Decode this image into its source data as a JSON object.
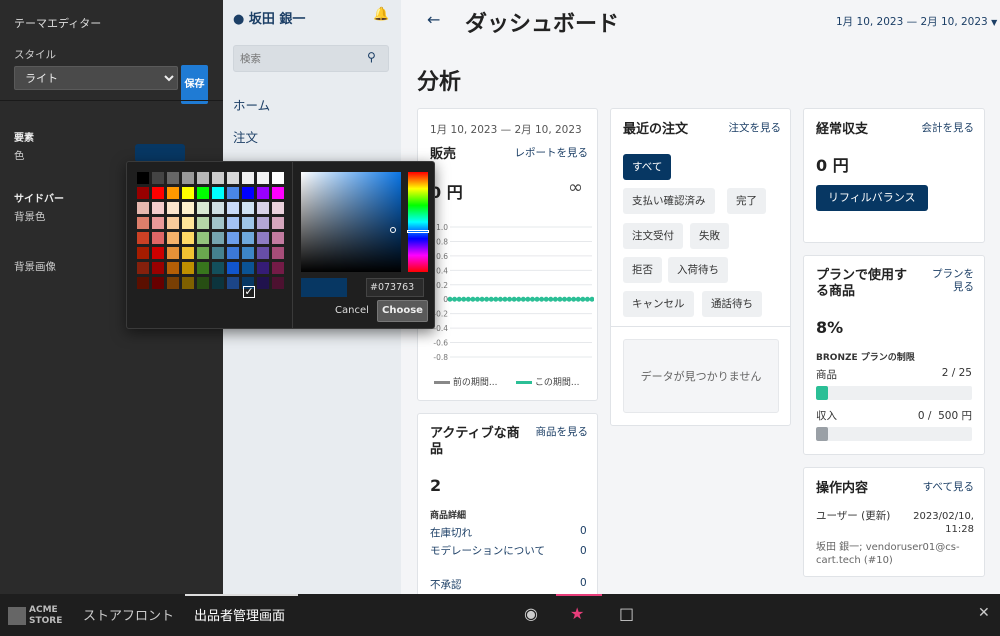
{
  "theme_editor": {
    "title": "テーマエディター",
    "style_label": "スタイル",
    "style_value": "ライト",
    "save_label": "保存",
    "elements_heading": "要素",
    "color_label": "色",
    "sidebar_heading": "サイドバー",
    "bg_color_label": "背景色",
    "bg_image_label": "背景画像",
    "selected_color": "#073763"
  },
  "sidebar": {
    "user_name": "坂田 銀一",
    "search_placeholder": "検索",
    "items": [
      "ホーム",
      "注文"
    ]
  },
  "header": {
    "title": "ダッシュボード",
    "date_range": "1月 10, 2023 — 2月 10, 2023"
  },
  "section_title": "分析",
  "sales": {
    "date_range": "1月 10, 2023 — 2月 10, 2023",
    "title": "販売",
    "link": "レポートを見る",
    "amount": "0 円",
    "infinity": "∞",
    "legend": [
      "前の期間...",
      "この期間..."
    ]
  },
  "chart_data": {
    "type": "line",
    "y_ticks": [
      "1.0",
      "0.8",
      "0.6",
      "0.4",
      "0.2",
      "0",
      "-0.2",
      "-0.4",
      "-0.6",
      "-0.8"
    ],
    "ylim": [
      -0.8,
      1.0
    ],
    "series": [
      {
        "name": "前の期間...",
        "color": "#888888",
        "values": []
      },
      {
        "name": "この期間...",
        "color": "#2bbf96",
        "values": [
          0,
          0,
          0,
          0,
          0,
          0,
          0,
          0,
          0,
          0,
          0,
          0,
          0,
          0,
          0,
          0,
          0,
          0,
          0,
          0,
          0,
          0,
          0,
          0,
          0,
          0,
          0,
          0,
          0,
          0,
          0,
          0
        ]
      }
    ]
  },
  "orders": {
    "title": "最近の注文",
    "link": "注文を見る",
    "filters": [
      "すべて",
      "支払い確認済み",
      "完了",
      "注文受付",
      "失敗",
      "拒否",
      "入荷待ち",
      "キャンセル",
      "通話待ち"
    ],
    "empty": "データが見つかりません"
  },
  "revenue": {
    "title": "経常収支",
    "link": "会計を見る",
    "amount": "0 円",
    "refill": "リフィルバランス"
  },
  "plan": {
    "title": "プランで使用する商品",
    "link": "プランを見る",
    "percent": "8%",
    "limits_title": "BRONZE プランの制限",
    "products_label": "商品",
    "products_value": "2 / 25",
    "products_fraction": 0.08,
    "income_label": "収入",
    "income_value": "0 /  500 円",
    "income_fraction": 0.0,
    "bar_color_products": "#2bbf96",
    "bar_color_income": "#9aa0a6"
  },
  "activity": {
    "title": "操作内容",
    "link": "すべて見る",
    "event": "ユーザー (更新)",
    "time": "2023/02/10, 11:28",
    "detail": "坂田 銀一; vendoruser01@cs-cart.tech (#10)"
  },
  "active": {
    "title": "アクティブな商品",
    "link": "商品を見る",
    "count": "2",
    "details_title": "商品詳細",
    "rows": [
      {
        "label": "在庫切れ",
        "value": "0"
      },
      {
        "label": "モデレーションについて",
        "value": "0"
      },
      {
        "label": "不承認",
        "value": "0"
      }
    ]
  },
  "color_picker": {
    "hex": "#073763",
    "cancel": "Cancel",
    "choose": "Choose",
    "palette": [
      "#000000",
      "#444444",
      "#666666",
      "#999999",
      "#b7b7b7",
      "#cccccc",
      "#d9d9d9",
      "#efefef",
      "#f3f3f3",
      "#ffffff",
      "#980000",
      "#ff0000",
      "#ff9900",
      "#ffff00",
      "#00ff00",
      "#00ffff",
      "#4a86e8",
      "#0000ff",
      "#9900ff",
      "#ff00ff",
      "#e6b8af",
      "#f4cccc",
      "#fce5cd",
      "#fff2cc",
      "#d9ead3",
      "#d0e0e3",
      "#c9daf8",
      "#cfe2f3",
      "#d9d2e9",
      "#ead1dc",
      "#dd7e6b",
      "#ea9999",
      "#f9cb9c",
      "#ffe599",
      "#b6d7a8",
      "#a2c4c9",
      "#a4c2f4",
      "#9fc5e8",
      "#b4a7d6",
      "#d5a6bd",
      "#cc4125",
      "#e06666",
      "#f6b26b",
      "#ffd966",
      "#93c47d",
      "#76a5af",
      "#6d9eeb",
      "#6fa8dc",
      "#8e7cc3",
      "#c27ba0",
      "#a61c00",
      "#cc0000",
      "#e69138",
      "#f1c232",
      "#6aa84f",
      "#45818e",
      "#3c78d8",
      "#3d85c6",
      "#674ea7",
      "#a64d79",
      "#85200c",
      "#990000",
      "#b45f06",
      "#bf9000",
      "#38761d",
      "#134f5c",
      "#1155cc",
      "#0b5394",
      "#351c75",
      "#741b47",
      "#5b0f00",
      "#660000",
      "#783f04",
      "#7f6000",
      "#274e13",
      "#0c343d",
      "#1c4587",
      "#073763",
      "#20124d",
      "#4c1130"
    ]
  },
  "bottom_bar": {
    "logo_line1": "ACME",
    "logo_line2": "STORE",
    "storefront": "ストアフロント",
    "vendor_panel": "出品者管理画面"
  }
}
